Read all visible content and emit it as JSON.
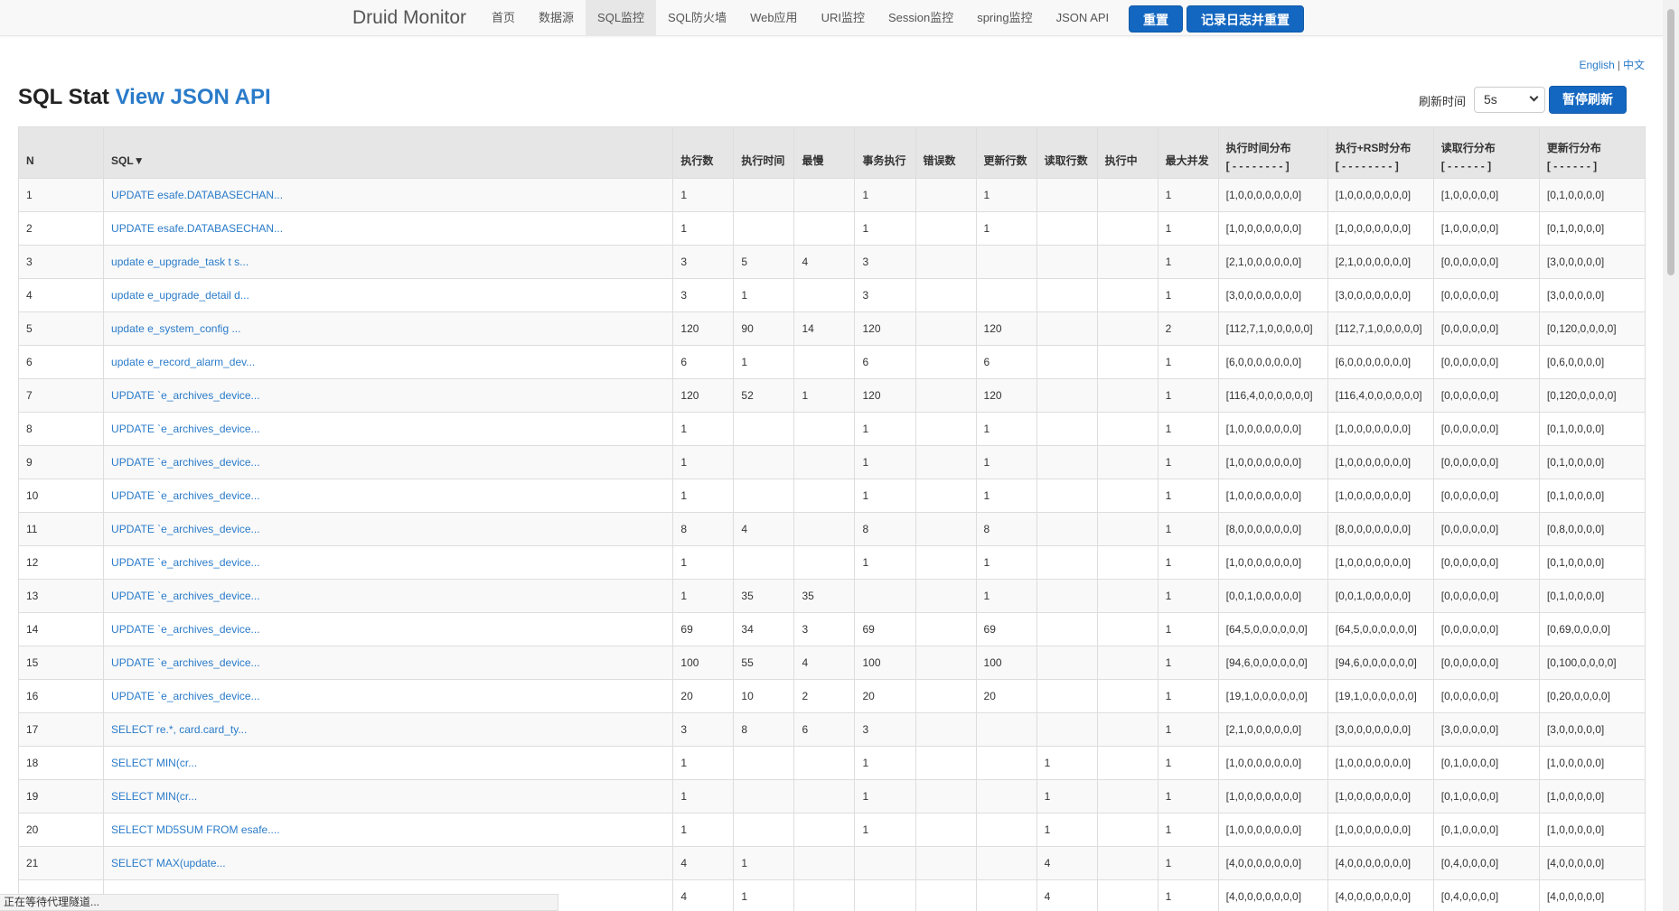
{
  "navbar": {
    "brand": "Druid Monitor",
    "items": [
      {
        "label": "首页"
      },
      {
        "label": "数据源"
      },
      {
        "label": "SQL监控",
        "active": true
      },
      {
        "label": "SQL防火墙"
      },
      {
        "label": "Web应用"
      },
      {
        "label": "URI监控"
      },
      {
        "label": "Session监控"
      },
      {
        "label": "spring监控"
      },
      {
        "label": "JSON API"
      }
    ],
    "reset_label": "重置",
    "log_reset_label": "记录日志并重置"
  },
  "lang": {
    "english": "English",
    "separator": "|",
    "chinese": "中文"
  },
  "header": {
    "title": "SQL Stat",
    "api_link": "View JSON API",
    "refresh_label": "刷新时间",
    "refresh_value": "5s",
    "pause_label": "暂停刷新"
  },
  "table": {
    "columns": [
      {
        "key": "n",
        "label": "N"
      },
      {
        "key": "sql",
        "label": "SQL▼"
      },
      {
        "key": "exec",
        "label": "执行数"
      },
      {
        "key": "time",
        "label": "执行时间"
      },
      {
        "key": "slowest",
        "label": "最慢"
      },
      {
        "key": "tx",
        "label": "事务执行"
      },
      {
        "key": "err",
        "label": "错误数"
      },
      {
        "key": "upd",
        "label": "更新行数"
      },
      {
        "key": "read",
        "label": "读取行数"
      },
      {
        "key": "running",
        "label": "执行中"
      },
      {
        "key": "conc",
        "label": "最大并发"
      },
      {
        "key": "h1",
        "label": "执行时间分布",
        "sub": "[ - - - - - - - - ]"
      },
      {
        "key": "h2",
        "label": "执行+RS时分布",
        "sub": "[ - - - - - - - - ]"
      },
      {
        "key": "h3",
        "label": "读取行分布",
        "sub": "[ - - - - - - ]"
      },
      {
        "key": "h4",
        "label": "更新行分布",
        "sub": "[ - - - - - - ]"
      }
    ],
    "rows": [
      [
        "1",
        "UPDATE esafe.DATABASECHAN...",
        "1",
        "",
        "",
        "1",
        "",
        "1",
        "",
        "",
        "1",
        "[1,0,0,0,0,0,0,0]",
        "[1,0,0,0,0,0,0,0]",
        "[1,0,0,0,0,0]",
        "[0,1,0,0,0,0]"
      ],
      [
        "2",
        "UPDATE esafe.DATABASECHAN...",
        "1",
        "",
        "",
        "1",
        "",
        "1",
        "",
        "",
        "1",
        "[1,0,0,0,0,0,0,0]",
        "[1,0,0,0,0,0,0,0]",
        "[1,0,0,0,0,0]",
        "[0,1,0,0,0,0]"
      ],
      [
        "3",
        "update e_upgrade_task t s...",
        "3",
        "5",
        "4",
        "3",
        "",
        "",
        "",
        "",
        "1",
        "[2,1,0,0,0,0,0,0]",
        "[2,1,0,0,0,0,0,0]",
        "[0,0,0,0,0,0]",
        "[3,0,0,0,0,0]"
      ],
      [
        "4",
        "update e_upgrade_detail d...",
        "3",
        "1",
        "",
        "3",
        "",
        "",
        "",
        "",
        "1",
        "[3,0,0,0,0,0,0,0]",
        "[3,0,0,0,0,0,0,0]",
        "[0,0,0,0,0,0]",
        "[3,0,0,0,0,0]"
      ],
      [
        "5",
        "update e_system_config ...",
        "120",
        "90",
        "14",
        "120",
        "",
        "120",
        "",
        "",
        "2",
        "[112,7,1,0,0,0,0,0]",
        "[112,7,1,0,0,0,0,0]",
        "[0,0,0,0,0,0]",
        "[0,120,0,0,0,0]"
      ],
      [
        "6",
        "update e_record_alarm_dev...",
        "6",
        "1",
        "",
        "6",
        "",
        "6",
        "",
        "",
        "1",
        "[6,0,0,0,0,0,0,0]",
        "[6,0,0,0,0,0,0,0]",
        "[0,0,0,0,0,0]",
        "[0,6,0,0,0,0]"
      ],
      [
        "7",
        "UPDATE `e_archives_device...",
        "120",
        "52",
        "1",
        "120",
        "",
        "120",
        "",
        "",
        "1",
        "[116,4,0,0,0,0,0,0]",
        "[116,4,0,0,0,0,0,0]",
        "[0,0,0,0,0,0]",
        "[0,120,0,0,0,0]"
      ],
      [
        "8",
        "UPDATE `e_archives_device...",
        "1",
        "",
        "",
        "1",
        "",
        "1",
        "",
        "",
        "1",
        "[1,0,0,0,0,0,0,0]",
        "[1,0,0,0,0,0,0,0]",
        "[0,0,0,0,0,0]",
        "[0,1,0,0,0,0]"
      ],
      [
        "9",
        "UPDATE `e_archives_device...",
        "1",
        "",
        "",
        "1",
        "",
        "1",
        "",
        "",
        "1",
        "[1,0,0,0,0,0,0,0]",
        "[1,0,0,0,0,0,0,0]",
        "[0,0,0,0,0,0]",
        "[0,1,0,0,0,0]"
      ],
      [
        "10",
        "UPDATE `e_archives_device...",
        "1",
        "",
        "",
        "1",
        "",
        "1",
        "",
        "",
        "1",
        "[1,0,0,0,0,0,0,0]",
        "[1,0,0,0,0,0,0,0]",
        "[0,0,0,0,0,0]",
        "[0,1,0,0,0,0]"
      ],
      [
        "11",
        "UPDATE `e_archives_device...",
        "8",
        "4",
        "",
        "8",
        "",
        "8",
        "",
        "",
        "1",
        "[8,0,0,0,0,0,0,0]",
        "[8,0,0,0,0,0,0,0]",
        "[0,0,0,0,0,0]",
        "[0,8,0,0,0,0]"
      ],
      [
        "12",
        "UPDATE `e_archives_device...",
        "1",
        "",
        "",
        "1",
        "",
        "1",
        "",
        "",
        "1",
        "[1,0,0,0,0,0,0,0]",
        "[1,0,0,0,0,0,0,0]",
        "[0,0,0,0,0,0]",
        "[0,1,0,0,0,0]"
      ],
      [
        "13",
        "UPDATE `e_archives_device...",
        "1",
        "35",
        "35",
        "",
        "",
        "1",
        "",
        "",
        "1",
        "[0,0,1,0,0,0,0,0]",
        "[0,0,1,0,0,0,0,0]",
        "[0,0,0,0,0,0]",
        "[0,1,0,0,0,0]"
      ],
      [
        "14",
        "UPDATE `e_archives_device...",
        "69",
        "34",
        "3",
        "69",
        "",
        "69",
        "",
        "",
        "1",
        "[64,5,0,0,0,0,0,0]",
        "[64,5,0,0,0,0,0,0]",
        "[0,0,0,0,0,0]",
        "[0,69,0,0,0,0]"
      ],
      [
        "15",
        "UPDATE `e_archives_device...",
        "100",
        "55",
        "4",
        "100",
        "",
        "100",
        "",
        "",
        "1",
        "[94,6,0,0,0,0,0,0]",
        "[94,6,0,0,0,0,0,0]",
        "[0,0,0,0,0,0]",
        "[0,100,0,0,0,0]"
      ],
      [
        "16",
        "UPDATE `e_archives_device...",
        "20",
        "10",
        "2",
        "20",
        "",
        "20",
        "",
        "",
        "1",
        "[19,1,0,0,0,0,0,0]",
        "[19,1,0,0,0,0,0,0]",
        "[0,0,0,0,0,0]",
        "[0,20,0,0,0,0]"
      ],
      [
        "17",
        "SELECT re.*, card.card_ty...",
        "3",
        "8",
        "6",
        "3",
        "",
        "",
        "",
        "",
        "1",
        "[2,1,0,0,0,0,0,0]",
        "[3,0,0,0,0,0,0,0]",
        "[3,0,0,0,0,0]",
        "[3,0,0,0,0,0]"
      ],
      [
        "18",
        "SELECT MIN(cr...",
        "1",
        "",
        "",
        "1",
        "",
        "",
        "1",
        "",
        "1",
        "[1,0,0,0,0,0,0,0]",
        "[1,0,0,0,0,0,0,0]",
        "[0,1,0,0,0,0]",
        "[1,0,0,0,0,0]"
      ],
      [
        "19",
        "SELECT MIN(cr...",
        "1",
        "",
        "",
        "1",
        "",
        "",
        "1",
        "",
        "1",
        "[1,0,0,0,0,0,0,0]",
        "[1,0,0,0,0,0,0,0]",
        "[0,1,0,0,0,0]",
        "[1,0,0,0,0,0]"
      ],
      [
        "20",
        "SELECT MD5SUM FROM esafe....",
        "1",
        "",
        "",
        "1",
        "",
        "",
        "1",
        "",
        "1",
        "[1,0,0,0,0,0,0,0]",
        "[1,0,0,0,0,0,0,0]",
        "[0,1,0,0,0,0]",
        "[1,0,0,0,0,0]"
      ],
      [
        "21",
        "SELECT MAX(update...",
        "4",
        "1",
        "",
        "",
        "",
        "",
        "4",
        "",
        "1",
        "[4,0,0,0,0,0,0,0]",
        "[4,0,0,0,0,0,0,0]",
        "[0,4,0,0,0,0]",
        "[4,0,0,0,0,0]"
      ],
      [
        "",
        "",
        "4",
        "1",
        "",
        "",
        "",
        "",
        "4",
        "",
        "1",
        "[4,0,0,0,0,0,0,0]",
        "[4,0,0,0,0,0,0,0]",
        "[0,4,0,0,0,0]",
        "[4,0,0,0,0,0]"
      ]
    ]
  },
  "status_bar": {
    "text": "正在等待代理隧道..."
  }
}
